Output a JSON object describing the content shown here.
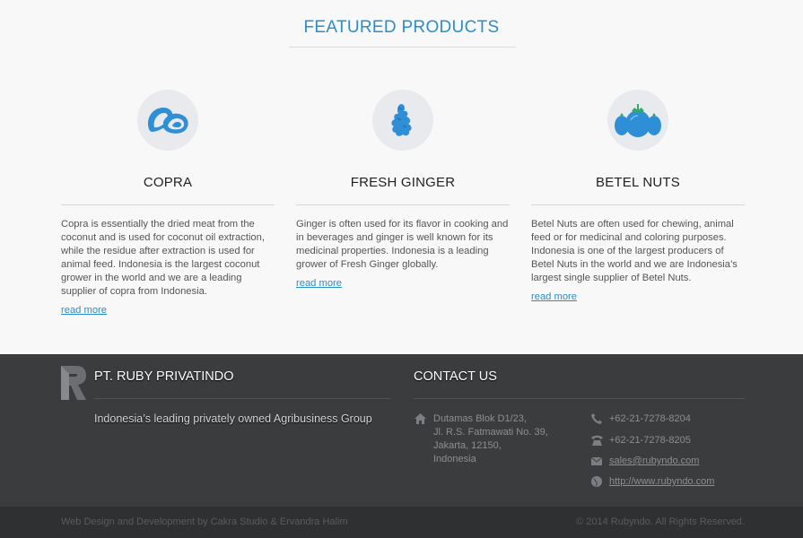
{
  "featured": {
    "title": "FEATURED PRODUCTS",
    "products": [
      {
        "name": "COPRA",
        "icon": "copra-icon",
        "description": "Copra is essentially the dried meat from the coconut and is used for coconut oil extraction, while the residue after extraction is used for animal feed. Indonesia is the largest coconut grower in the world and we are a leading supplier of copra from Indonesia.",
        "link_label": "read more"
      },
      {
        "name": "FRESH GINGER",
        "icon": "ginger-icon",
        "description": "Ginger is often used for its flavor in cooking and in beverages and ginger is well known for its medicinal properties. Indonesia is a leading grower of Fresh Ginger globally.",
        "link_label": "read more"
      },
      {
        "name": "BETEL NUTS",
        "icon": "betel-nut-icon",
        "description": "Betel Nuts are often used for chewing, animal feed or for medicinal and coloring purposes. Indonesia is one of the largest producers of Betel Nuts in the world and we are Indonesia’s largest single supplier of Betel Nuts.",
        "link_label": "read more"
      }
    ]
  },
  "footer": {
    "company_name": "PT. RUBY PRIVATINDO",
    "tagline": "Indonesia’s leading privately owned Agribusiness Group",
    "contact_title": "CONTACT US",
    "address_lines": [
      "Dutamas Blok D1/23,",
      "Jl. R.S. Fatmawati No. 39,",
      "Jakarta, 12150,",
      "Indonesia"
    ],
    "phone": "+62-21-7278-8204",
    "fax": "+62-21-7278-8205",
    "email": "sales@rubyndo.com",
    "website": "http://www.rubyndo.com"
  },
  "bottom": {
    "credit": "Web Design and Development by Cakra Studio & Ervandra Halim",
    "copyright": "© 2014 Rubyndo. All Rights Reserved."
  },
  "colors": {
    "accent": "#2a8fc7",
    "icon_blue": "#2f8fd6",
    "footer_bg": "#3b3c3e",
    "bottom_bg": "#2f3032"
  }
}
